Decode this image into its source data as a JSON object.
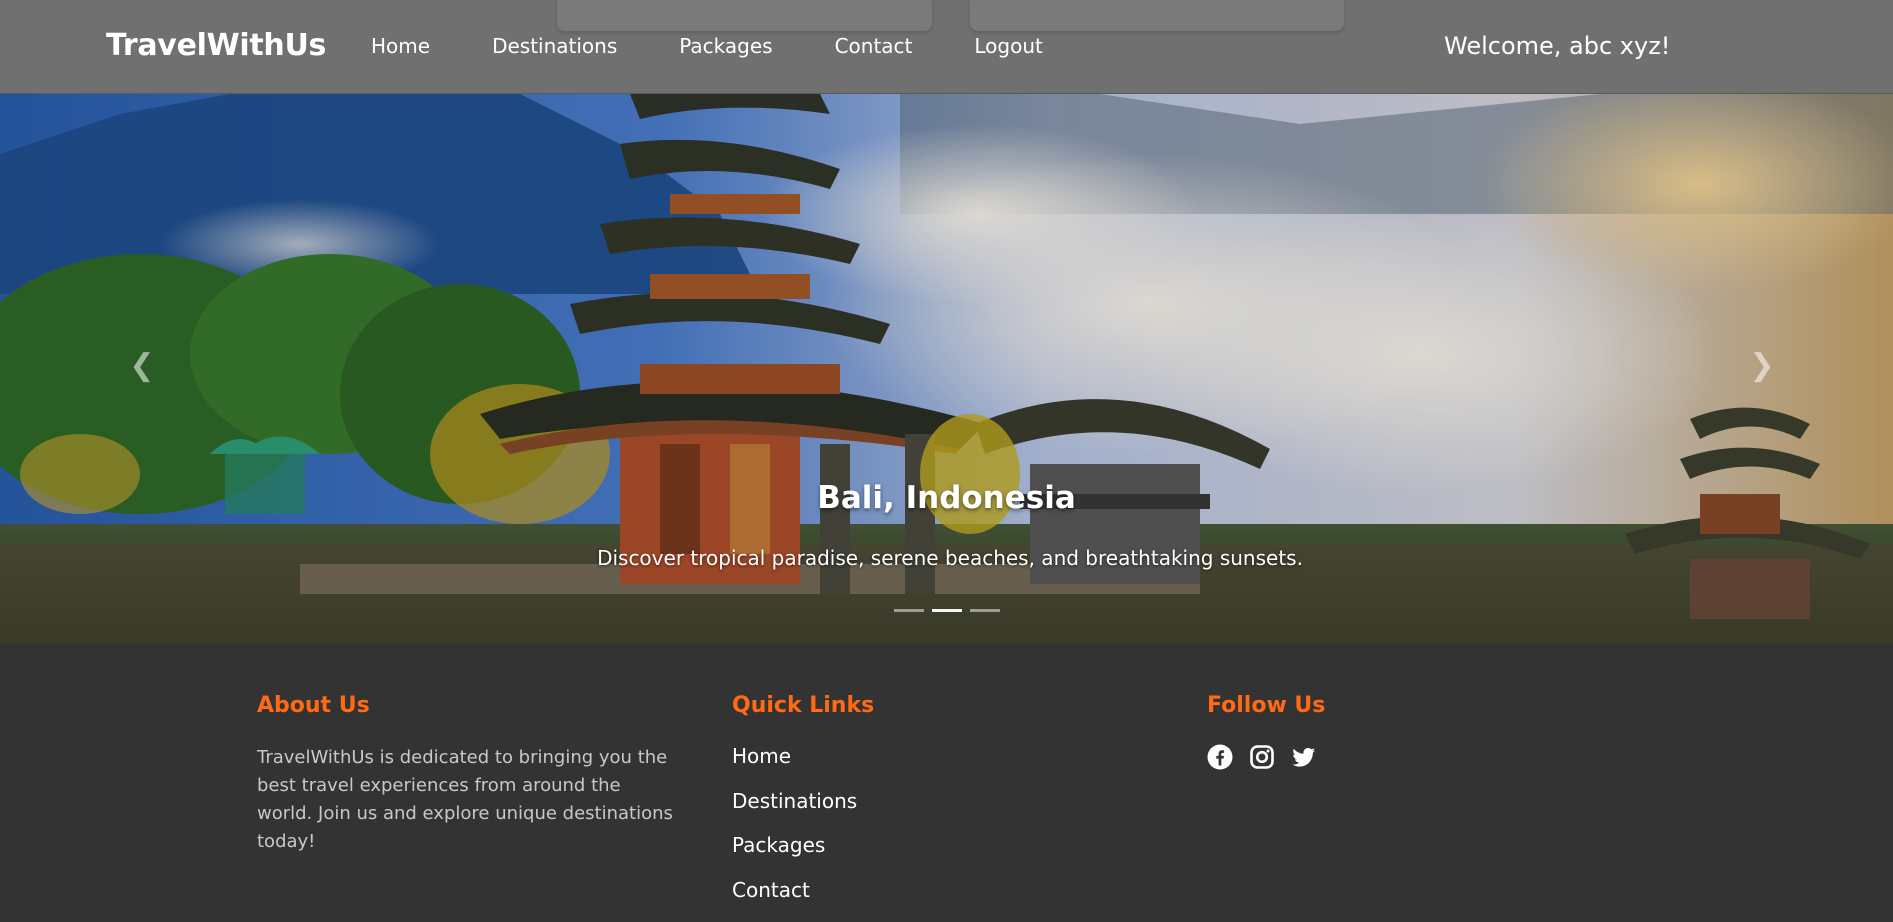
{
  "header": {
    "brand": "TravelWithUs",
    "nav": [
      {
        "label": "Home"
      },
      {
        "label": "Destinations"
      },
      {
        "label": "Packages"
      },
      {
        "label": "Contact"
      },
      {
        "label": "Logout"
      }
    ],
    "welcome": "Welcome, abc xyz!"
  },
  "hero": {
    "title": "Bali, Indonesia",
    "subtitle": "Discover tropical paradise, serene beaches, and breathtaking sunsets.",
    "prev_icon": "chevron-left-icon",
    "next_icon": "chevron-right-icon"
  },
  "footer": {
    "about": {
      "heading": "About Us",
      "text": "TravelWithUs is dedicated to bringing you the best travel experiences from around the world. Join us and explore unique destinations today!"
    },
    "quick_links": {
      "heading": "Quick Links",
      "items": [
        {
          "label": "Home"
        },
        {
          "label": "Destinations"
        },
        {
          "label": "Packages"
        },
        {
          "label": "Contact"
        }
      ]
    },
    "follow": {
      "heading": "Follow Us",
      "icons": [
        "facebook-icon",
        "instagram-icon",
        "twitter-icon"
      ]
    }
  },
  "colors": {
    "accent": "#ff6a13",
    "header_bg": "#707070",
    "footer_bg": "#333333"
  }
}
